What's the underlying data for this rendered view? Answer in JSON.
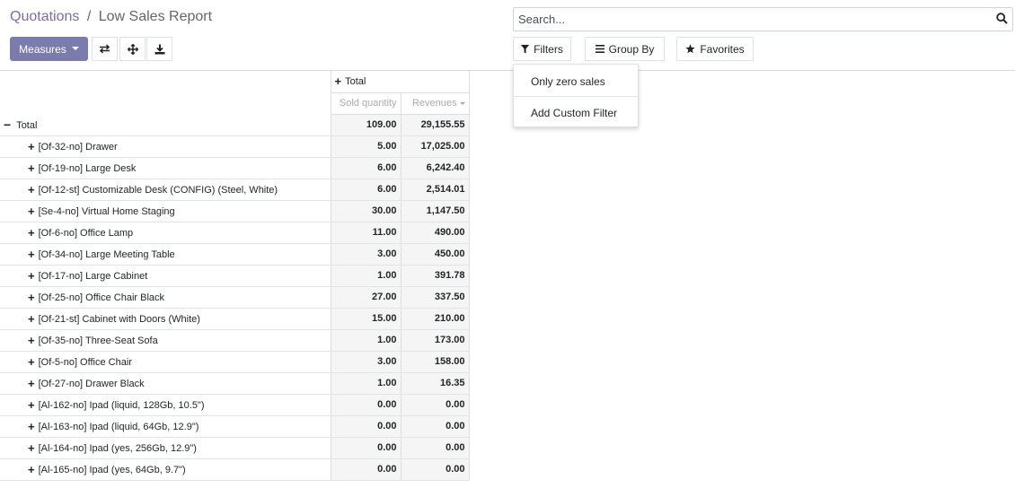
{
  "breadcrumb": {
    "parent": "Quotations",
    "separator": "/",
    "current": "Low Sales Report"
  },
  "toolbar": {
    "measures_label": "Measures"
  },
  "search": {
    "placeholder": "Search..."
  },
  "filters": {
    "filters_label": "Filters",
    "groupby_label": "Group By",
    "favorites_label": "Favorites",
    "dropdown_items": [
      "Only zero sales",
      "Add Custom Filter"
    ]
  },
  "pivot": {
    "column_header": "Total",
    "measures": [
      "Sold quantity",
      "Revenues"
    ],
    "total_row": {
      "label": "Total",
      "qty": "109.00",
      "revenue": "29,155.55"
    },
    "rows": [
      {
        "label": "[Of-32-no] Drawer",
        "qty": "5.00",
        "revenue": "17,025.00"
      },
      {
        "label": "[Of-19-no] Large Desk",
        "qty": "6.00",
        "revenue": "6,242.40"
      },
      {
        "label": "[Of-12-st] Customizable Desk (CONFIG) (Steel, White)",
        "qty": "6.00",
        "revenue": "2,514.01"
      },
      {
        "label": "[Se-4-no] Virtual Home Staging",
        "qty": "30.00",
        "revenue": "1,147.50"
      },
      {
        "label": "[Of-6-no] Office Lamp",
        "qty": "11.00",
        "revenue": "490.00"
      },
      {
        "label": "[Of-34-no] Large Meeting Table",
        "qty": "3.00",
        "revenue": "450.00"
      },
      {
        "label": "[Of-17-no] Large Cabinet",
        "qty": "1.00",
        "revenue": "391.78"
      },
      {
        "label": "[Of-25-no] Office Chair Black",
        "qty": "27.00",
        "revenue": "337.50"
      },
      {
        "label": "[Of-21-st] Cabinet with Doors (White)",
        "qty": "15.00",
        "revenue": "210.00"
      },
      {
        "label": "[Of-35-no] Three-Seat Sofa",
        "qty": "1.00",
        "revenue": "173.00"
      },
      {
        "label": "[Of-5-no] Office Chair",
        "qty": "3.00",
        "revenue": "158.00"
      },
      {
        "label": "[Of-27-no] Drawer Black",
        "qty": "1.00",
        "revenue": "16.35"
      },
      {
        "label": "[Al-162-no] Ipad (liquid, 128Gb, 10.5\")",
        "qty": "0.00",
        "revenue": "0.00"
      },
      {
        "label": "[Al-163-no] Ipad (liquid, 64Gb, 12.9\")",
        "qty": "0.00",
        "revenue": "0.00"
      },
      {
        "label": "[Al-164-no] Ipad (yes, 256Gb, 12.9\")",
        "qty": "0.00",
        "revenue": "0.00"
      },
      {
        "label": "[Al-165-no] Ipad (yes, 64Gb, 9.7\")",
        "qty": "0.00",
        "revenue": "0.00"
      }
    ]
  },
  "colors": {
    "brand": "#7c7bad",
    "breadcrumb_link": "#7c6ba1",
    "measure_header_text": "#aaaaaa",
    "cell_background": "#f5f5f5"
  },
  "icons": {
    "flip_axis": "flip-axis-icon",
    "expand_all": "expand-all-icon",
    "download": "download-icon",
    "search": "search-icon",
    "filter": "filter-icon",
    "group_by": "list-icon",
    "favorites": "star-icon",
    "expand_row": "plus-icon",
    "collapse_row": "minus-icon"
  }
}
